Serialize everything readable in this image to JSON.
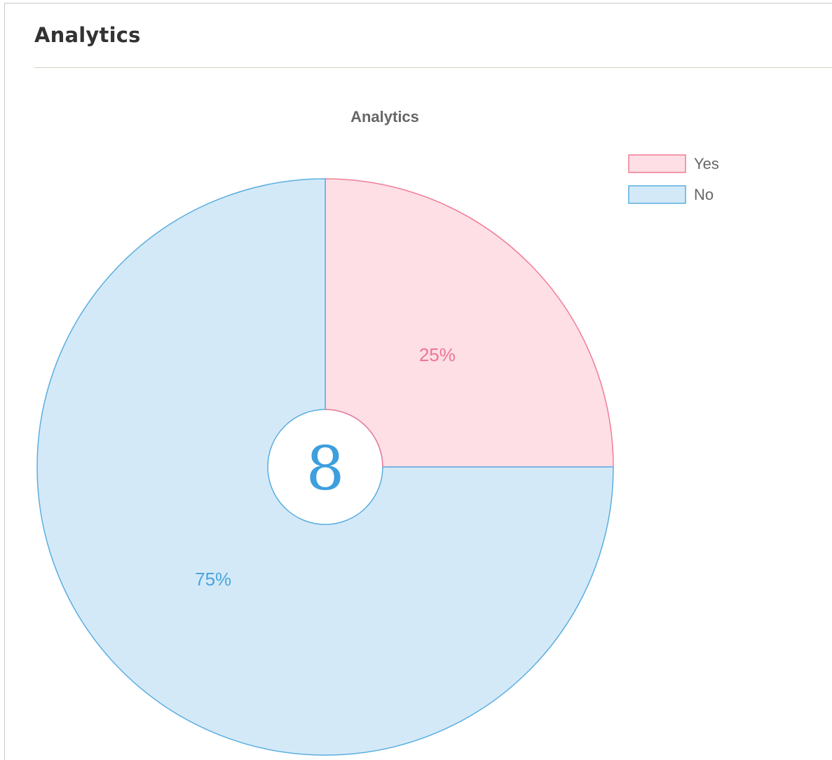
{
  "panel": {
    "title": "Analytics"
  },
  "chart_data": {
    "type": "pie",
    "title": "Analytics",
    "categories": [
      "Yes",
      "No"
    ],
    "values": [
      25,
      75
    ],
    "value_labels": [
      "25%",
      "75%"
    ],
    "center_label": "8",
    "legend": {
      "placement": "top-right",
      "entries": [
        "Yes",
        "No"
      ]
    },
    "colors": {
      "Yes": {
        "fill": "#fddfe5",
        "stroke": "#f07c97",
        "label": "#ec7694"
      },
      "No": {
        "fill": "#d4e9f8",
        "stroke": "#5aaee0",
        "label": "#4ba4dc"
      },
      "center_text": "#3d9fde",
      "title": "#666666",
      "legend_text": "#666666"
    }
  }
}
